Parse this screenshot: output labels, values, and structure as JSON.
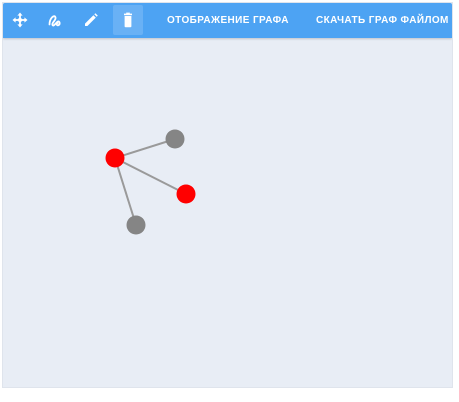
{
  "toolbar": {
    "tools": [
      {
        "name": "move-tool",
        "icon": "move-arrows-icon"
      },
      {
        "name": "draw-edge-tool",
        "icon": "squiggle-path-icon"
      },
      {
        "name": "edit-tool",
        "icon": "pencil-icon"
      },
      {
        "name": "delete-tool",
        "icon": "trash-icon",
        "active": true
      }
    ],
    "display_graph_label": "ОТОБРАЖЕНИЕ ГРАФА",
    "download_graph_label": "СКАЧАТЬ ГРАФ ФАЙЛОМ"
  },
  "colors": {
    "toolbar_bg": "#4da3f3",
    "canvas_bg": "#e8edf5",
    "node_selected": "#ff0000",
    "node_default": "#858585",
    "edge": "#9a9a9a"
  },
  "graph": {
    "nodes": [
      {
        "id": "n1",
        "state": "selected"
      },
      {
        "id": "n2",
        "state": "default"
      },
      {
        "id": "n3",
        "state": "selected"
      },
      {
        "id": "n4",
        "state": "default"
      }
    ],
    "edges": [
      {
        "source": "n1",
        "target": "n2"
      },
      {
        "source": "n1",
        "target": "n3"
      },
      {
        "source": "n1",
        "target": "n4"
      }
    ]
  }
}
